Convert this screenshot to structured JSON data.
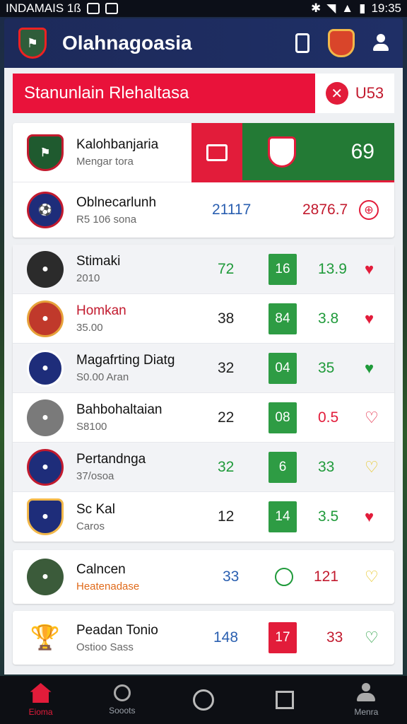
{
  "status_bar": {
    "left_text": "INDAMAIS 1ß",
    "time": "19:35"
  },
  "app": {
    "title": "Olahnagoasia"
  },
  "banner": {
    "title": "Stanunlain Rlehaltasa",
    "code": "U53"
  },
  "header_card": {
    "row1": {
      "name": "Kalohbanjaria",
      "sub": "Mengar tora",
      "score": "69"
    },
    "row2": {
      "name": "Oblnecarlunh",
      "sub": "R5 106 sona",
      "value_a": "21117",
      "value_b": "2876.7"
    }
  },
  "rows_group1": [
    {
      "name": "Stimaki",
      "sub": "2010",
      "a": "72",
      "a_color": "#1f9a3a",
      "b": "16",
      "b_color": "#2e9c44",
      "c": "13.9",
      "c_color": "#1f9a3a",
      "d_color": "#e21c3a",
      "d_icon": "heart-icon"
    },
    {
      "name": "Homkan",
      "sub": "35.00",
      "a": "38",
      "a_color": "#222222",
      "b": "84",
      "b_color": "#2e9c44",
      "c": "3.8",
      "c_color": "#1f9a3a",
      "d_color": "#e21c3a",
      "d_icon": "heart-icon"
    },
    {
      "name": "Magafrting Diatg",
      "sub": "S0.00 Aran",
      "a": "32",
      "a_color": "#222222",
      "b": "04",
      "b_color": "#2e9c44",
      "c": "35",
      "c_color": "#1f9a3a",
      "d_color": "#1f9a3a",
      "d_icon": "heart-icon"
    },
    {
      "name": "Bahbohaltaian",
      "sub": "S8100",
      "a": "22",
      "a_color": "#222222",
      "b": "08",
      "b_color": "#2e9c44",
      "c": "0.5",
      "c_color": "#e21c3a",
      "d_color": "#e21c3a",
      "d_icon": "heart-outline-icon"
    },
    {
      "name": "Pertandnga",
      "sub": "37/osoa",
      "a": "32",
      "a_color": "#1f9a3a",
      "b": "6",
      "b_color": "#2e9c44",
      "c": "33",
      "c_color": "#1f9a3a",
      "d_color": "#e6c41c",
      "d_icon": "heart-outline-icon"
    },
    {
      "name": "Sc Kal",
      "sub": "Caros",
      "a": "12",
      "a_color": "#222222",
      "b": "14",
      "b_color": "#2e9c44",
      "c": "3.5",
      "c_color": "#1f9a3a",
      "d_color": "#e21c3a",
      "d_icon": "heart-icon"
    }
  ],
  "row_single1": {
    "name": "Calncen",
    "sub": "Heatenadase",
    "a": "33",
    "b": "⊖",
    "c": "121"
  },
  "row_single2": {
    "name": "Peadan Tonio",
    "sub": "Ostioo Sass",
    "a": "148",
    "b": "17",
    "c": "33"
  },
  "nav": [
    {
      "label": "Eioma"
    },
    {
      "label": "Sooots"
    },
    {
      "label": ""
    },
    {
      "label": ""
    },
    {
      "label": "Menra"
    }
  ]
}
